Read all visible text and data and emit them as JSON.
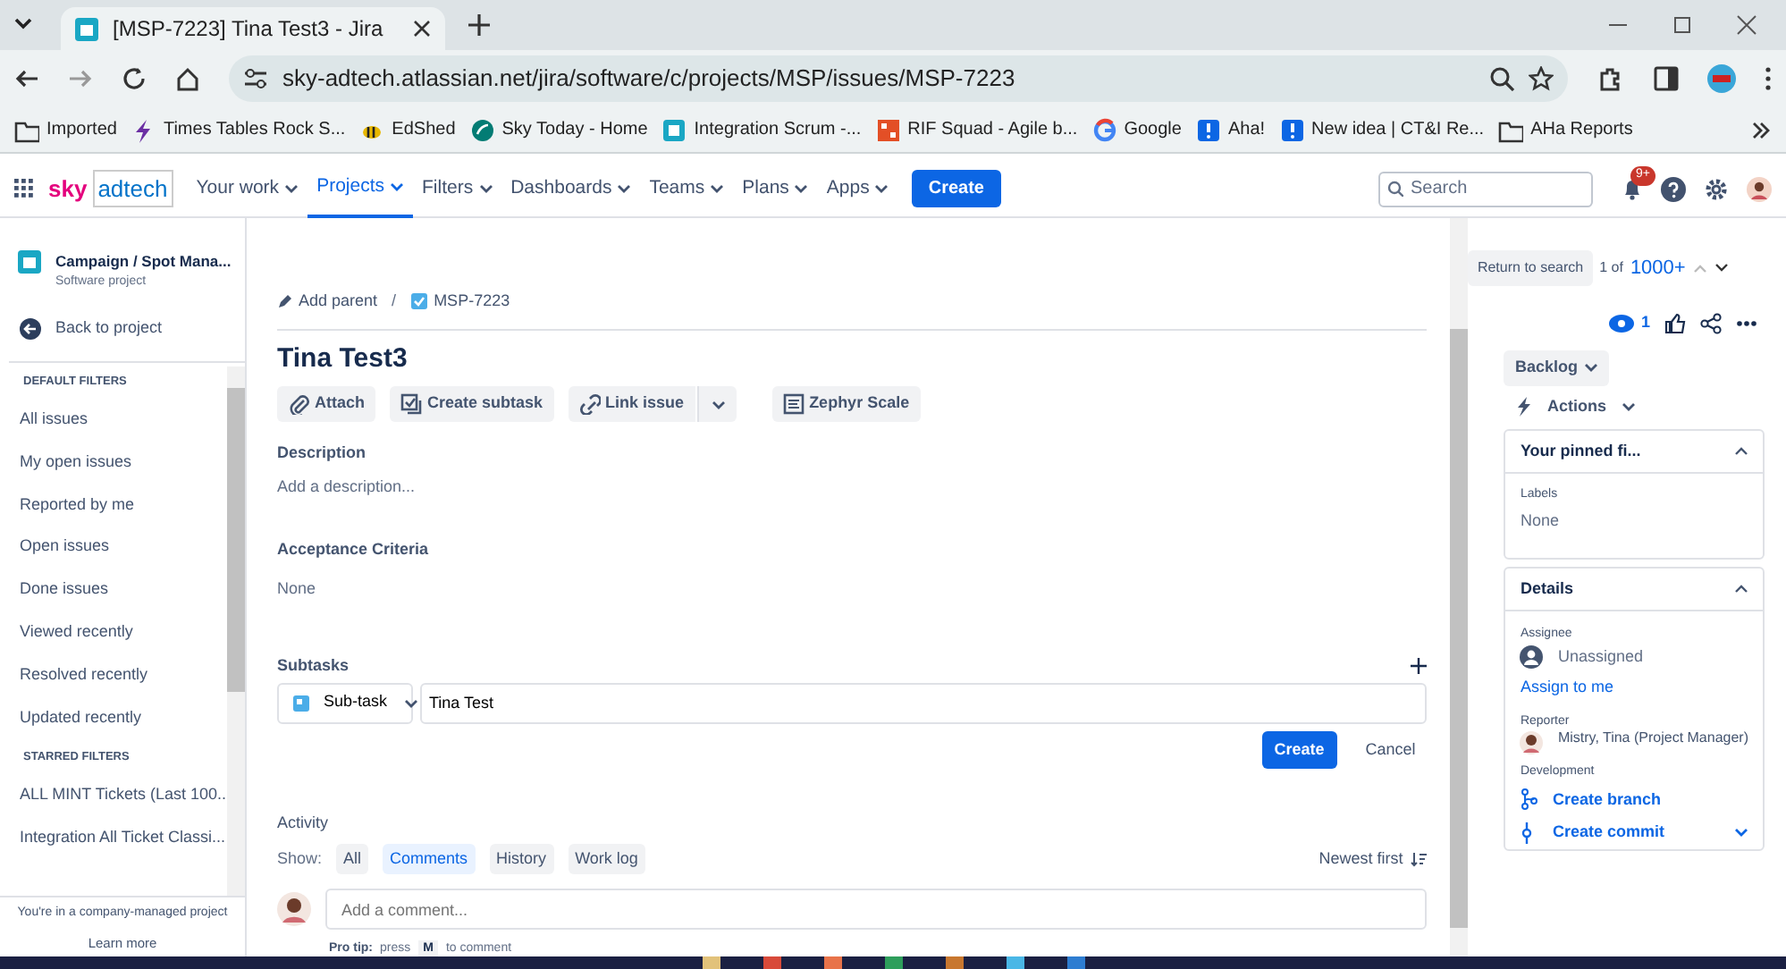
{
  "browser": {
    "tab_title": "[MSP-7223] Tina Test3 - Jira",
    "url": "sky-adtech.atlassian.net/jira/software/c/projects/MSP/issues/MSP-7223",
    "bookmarks": [
      {
        "label": "Imported"
      },
      {
        "label": "Times Tables Rock S..."
      },
      {
        "label": "EdShed"
      },
      {
        "label": "Sky Today - Home"
      },
      {
        "label": "Integration Scrum -..."
      },
      {
        "label": "RIF Squad - Agile b..."
      },
      {
        "label": "Google"
      },
      {
        "label": "Aha!"
      },
      {
        "label": "New idea | CT&I Re..."
      },
      {
        "label": "AHa Reports"
      }
    ]
  },
  "nav": {
    "logo": [
      "sky",
      "adtech"
    ],
    "menu": [
      {
        "label": "Your work",
        "selected": false
      },
      {
        "label": "Projects",
        "selected": true
      },
      {
        "label": "Filters",
        "selected": false
      },
      {
        "label": "Dashboards",
        "selected": false
      },
      {
        "label": "Teams",
        "selected": false
      },
      {
        "label": "Plans",
        "selected": false
      },
      {
        "label": "Apps",
        "selected": false
      }
    ],
    "create": "Create",
    "search_placeholder": "Search",
    "badge": "9+"
  },
  "sidebar": {
    "project_name": "Campaign / Spot Mana...",
    "project_type": "Software project",
    "back": "Back to project",
    "sections": [
      {
        "heading": "DEFAULT FILTERS",
        "items": [
          "All issues",
          "My open issues",
          "Reported by me",
          "Open issues",
          "Done issues",
          "Viewed recently",
          "Resolved recently",
          "Updated recently"
        ]
      },
      {
        "heading": "STARRED FILTERS",
        "items": [
          "ALL MINT Tickets (Last 100...",
          "Integration All Ticket Classi..."
        ]
      }
    ],
    "footer": "You're in a company-managed project",
    "learn_more": "Learn more"
  },
  "issue": {
    "add_parent": "Add parent",
    "separator": "/",
    "key": "MSP-7223",
    "title": "Tina Test3",
    "actions": [
      {
        "label": "Attach"
      },
      {
        "label": "Create subtask"
      },
      {
        "label": "Link issue"
      },
      {
        "label": "Zephyr Scale"
      }
    ],
    "description_label": "Description",
    "description_placeholder": "Add a description...",
    "acceptance_label": "Acceptance Criteria",
    "acceptance_value": "None",
    "subtasks_label": "Subtasks",
    "subtask_type": "Sub-task",
    "subtask_value": "Tina Test",
    "create": "Create",
    "cancel": "Cancel",
    "activity_label": "Activity",
    "show_label": "Show:",
    "filters": [
      {
        "label": "All",
        "selected": false
      },
      {
        "label": "Comments",
        "selected": true
      },
      {
        "label": "History",
        "selected": false
      },
      {
        "label": "Work log",
        "selected": false
      }
    ],
    "sort": "Newest first",
    "comment_placeholder": "Add a comment...",
    "tip_label": "Pro tip:",
    "tip_before": "press",
    "tip_key": "M",
    "tip_after": "to comment"
  },
  "side": {
    "return": "Return to search",
    "position": "1 of",
    "total": "1000+",
    "watchers": "1",
    "status": "Backlog",
    "actions": "Actions",
    "pinned_title": "Your pinned fi...",
    "labels_label": "Labels",
    "labels_value": "None",
    "details_title": "Details",
    "assignee_label": "Assignee",
    "assignee_value": "Unassigned",
    "assign_link": "Assign to me",
    "reporter_label": "Reporter",
    "reporter_value": "Mistry, Tina (Project Manager)",
    "development_label": "Development",
    "dev_links": [
      "Create branch",
      "Create commit"
    ]
  }
}
